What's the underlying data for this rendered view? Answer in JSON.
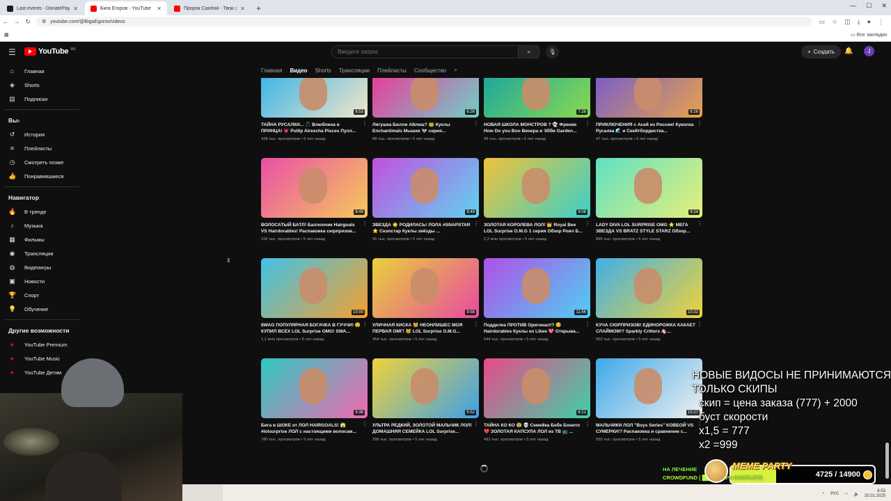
{
  "browser": {
    "tabs": [
      {
        "label": "Last events - DonatePay.ru",
        "active": false,
        "favicon_color": "#1a1a1a"
      },
      {
        "label": "Бига Егоров - YouTube",
        "active": true,
        "favicon_color": "#ff0000"
      },
      {
        "label": "Пророк Санбой - Твои зелёные...",
        "active": false,
        "favicon_color": "#ff0000"
      }
    ],
    "url": "youtube.com/@BigaEgorov/videos",
    "bookmarks_label": "Все закладки"
  },
  "youtube": {
    "logo_text": "YouTube",
    "region": "MX",
    "search_placeholder": "Введите запрос",
    "create_label": "Создать",
    "avatar_letter": "J"
  },
  "sidebar": {
    "main": [
      {
        "label": "Главная",
        "icon": "home-icon",
        "glyph": "⌂"
      },
      {
        "label": "Shorts",
        "icon": "shorts-icon",
        "glyph": "◈"
      },
      {
        "label": "Подписки",
        "icon": "subscriptions-icon",
        "glyph": "▤"
      }
    ],
    "you_heading": "Вы",
    "you": [
      {
        "label": "История",
        "icon": "history-icon",
        "glyph": "↺"
      },
      {
        "label": "Плейлисты",
        "icon": "playlists-icon",
        "glyph": "≡"
      },
      {
        "label": "Смотреть позже",
        "icon": "watch-later-icon",
        "glyph": "◷"
      },
      {
        "label": "Понравившиеся",
        "icon": "like-icon",
        "glyph": "👍"
      }
    ],
    "nav_heading": "Навигатор",
    "nav": [
      {
        "label": "В тренде",
        "icon": "trending-icon",
        "glyph": "🔥"
      },
      {
        "label": "Музыка",
        "icon": "music-icon",
        "glyph": "♪"
      },
      {
        "label": "Фильмы",
        "icon": "movies-icon",
        "glyph": "▦"
      },
      {
        "label": "Трансляции",
        "icon": "live-icon",
        "glyph": "◉"
      },
      {
        "label": "Видеоигры",
        "icon": "gaming-icon",
        "glyph": "◍"
      },
      {
        "label": "Новости",
        "icon": "news-icon",
        "glyph": "▣"
      },
      {
        "label": "Спорт",
        "icon": "sport-icon",
        "glyph": "🏆"
      },
      {
        "label": "Обучение",
        "icon": "learning-icon",
        "glyph": "💡"
      }
    ],
    "more_heading": "Другие возможности",
    "more": [
      {
        "label": "YouTube Premium",
        "icon": "yt-premium-icon",
        "glyph": "●"
      },
      {
        "label": "YouTube Music",
        "icon": "yt-music-icon",
        "glyph": "●"
      },
      {
        "label": "YouTube Детям",
        "icon": "yt-kids-icon",
        "glyph": "●"
      }
    ]
  },
  "channel_tabs": [
    {
      "label": "Главная",
      "active": false
    },
    {
      "label": "Видео",
      "active": true
    },
    {
      "label": "Shorts",
      "active": false
    },
    {
      "label": "Трансляции",
      "active": false
    },
    {
      "label": "Плейлисты",
      "active": false
    },
    {
      "label": "Сообщество",
      "active": false
    }
  ],
  "videos": [
    {
      "title": "ТАЙНА РУСАЛКИ... 🎵 Влюблена в ПРИНЦА! 💗 Pullip Alrescha Pisces Пулл...",
      "meta": "438 тыс. просмотров • 5 лет назад",
      "duration": "6:53",
      "c1": "#3fb6e8",
      "c2": "#f4e6c8"
    },
    {
      "title": "Лягушка Билли Айлиш? 🐸 Куклы Enchantimals Мышки 🐭 серия...",
      "meta": "88 тыс. просмотров • 5 лет назад",
      "duration": "6:26",
      "c1": "#e63f9a",
      "c2": "#6fd0c9"
    },
    {
      "title": "НОВАЯ ШКОЛА МОНСТРОВ ? 👻 Френки How Do you Boo Венера и Эбби Garden...",
      "meta": "99 тыс. просмотров • 5 лет назад",
      "duration": "7:28",
      "c1": "#1fa89c",
      "c2": "#8ad94e"
    },
    {
      "title": "ПРИКЛЮЧЕНИЯ с Асей из России! Куколка Русалка 🌊 и Скейтбордистка...",
      "meta": "47 тыс. просмотров • 5 лет назад",
      "duration": "6:26",
      "c1": "#7b5ec8",
      "c2": "#e8a24a"
    },
    {
      "title": "ВОЛОСАТЫЙ БАТЛ! Баллончик Hairgoals VS Hairdorables! Распаковка сюрпризов...",
      "meta": "118 тыс. просмотров • 5 лет назад",
      "duration": "8:49",
      "c1": "#ea4fa8",
      "c2": "#f7c95a"
    },
    {
      "title": "ЗВЕЗДА 🌟 РОДИЛАСЬ! ЛОЛА #SNAPSTAR ⭐ Снэпстар Куклы звёзды ...",
      "meta": "95 тыс. просмотров • 5 лет назад",
      "duration": "9:49",
      "c1": "#c34fe0",
      "c2": "#5fd4f0"
    },
    {
      "title": "ЗОЛОТАЯ КОРОЛЕВА ЛОЛ! 👑 Royal Bee LOL Surprise O.M.G 1 серия Обзор Роял Б...",
      "meta": "2,2 млн просмотров • 5 лет назад",
      "duration": "9:08",
      "c1": "#f0c23a",
      "c2": "#3ad0c8"
    },
    {
      "title": "LADY DIVA LOL SURPRISE OMG ⭐ МЕГА ЗВЕЗДА VS BRATZ STYLE STARZ Обзор...",
      "meta": "896 тыс. просмотров • 5 лет назад",
      "duration": "9:24",
      "c1": "#5fe0c4",
      "c2": "#e8f07a"
    },
    {
      "title": "$WAG ПОПУЛЯРНАЯ БОГАЧКА В ГУЧЧИ! 😲 КУПИЛ ВСЕХ LOL Surprise OMG! SWA...",
      "meta": "1,1 млн просмотров • 5 лет назад",
      "duration": "10:00",
      "c1": "#3fc3e8",
      "c2": "#f4a02f"
    },
    {
      "title": "УЛИЧНАЯ КИСКА 🐱 НЕОНЛИШЕС МОЯ ПЕРВАЯ ОМГ! 🐱 LOL Surprise O.M.G...",
      "meta": "454 тыс. просмотров • 5 лет назад",
      "duration": "9:58",
      "c1": "#e8d23a",
      "c2": "#e84aa0"
    },
    {
      "title": "Подделка ПРОТИВ Оригинал!? 😏 Hairdorables Куклы из Likee 💖 Открыва...",
      "meta": "544 тыс. просмотров • 5 лет назад",
      "duration": "11:56",
      "c1": "#b04fe8",
      "c2": "#4fd0f0"
    },
    {
      "title": "КУЧА СЮРПРИЗОВ! ЕДИНОРОЖКА КАКАЕТ СЛАЙМОМ!? Sparkly Critters 🦄...",
      "meta": "552 тыс. просмотров • 5 лет назад",
      "duration": "10:32",
      "c1": "#3fb0e8",
      "c2": "#f0d23a"
    },
    {
      "title": "Бига в ШОКЕ от ЛОЛ HAIRGOALS! 😱 #lolsurprise ЛОЛ с настоящими волосам...",
      "meta": "780 тыс. просмотров • 5 лет назад",
      "duration": "9:36",
      "c1": "#2ec8c0",
      "c2": "#f06ab0"
    },
    {
      "title": "УЛЬТРА РЕДКИЙ, ЗОЛОТОЙ МАЛЬЧИК ЛОЛ! ДОМАШНЯЯ СЕМЕЙКА LOL Surprise...",
      "meta": "296 тыс. просмотров • 5 лет назад",
      "duration": "5:52",
      "c1": "#f0d23a",
      "c2": "#3fa0e8"
    },
    {
      "title": "ТАЙНА КО КО 😨 💀 Семейка Бебе Бонито ❤️ ЗОЛОТАЯ КАПСУЛА ЛОЛ из ТВ 📺 ...",
      "meta": "491 тыс. просмотров • 5 лет назад",
      "duration": "8:21",
      "c1": "#e84a8a",
      "c2": "#3fd0a8"
    },
    {
      "title": "МАЛЬЧИКИ ЛОЛ \"Boys Series\" КОВБОЙ VS СУМЕРКИ!? Распаковка и сравнение с...",
      "meta": "550 тыс. просмотров • 5 лет назад",
      "duration": "10:27",
      "c1": "#3fa8e8",
      "c2": "#f0f0f0"
    }
  ],
  "stream_overlay": {
    "notice_lines": [
      "НОВЫЕ ВИДОСЫ НЕ ПРИНИМАЮТСЯ",
      "ТОЛЬКО СКИПЫ",
      "скип = цена заказа (777) + 2000",
      "буст скорости",
      "x1,5 = 777",
      "x2 =999"
    ],
    "donation": {
      "label_top": "НА ЛЕЧЕНИЕ",
      "crowdfund_text": "CROWDFUND [ ████ ] - 0% COMPLETE",
      "title": "MEME PARTY",
      "amount": "4725 / 14900",
      "progress": 0.317
    }
  },
  "taskbar": {
    "lang": "РУС",
    "time": "6:53",
    "date": "20.01.2025"
  }
}
